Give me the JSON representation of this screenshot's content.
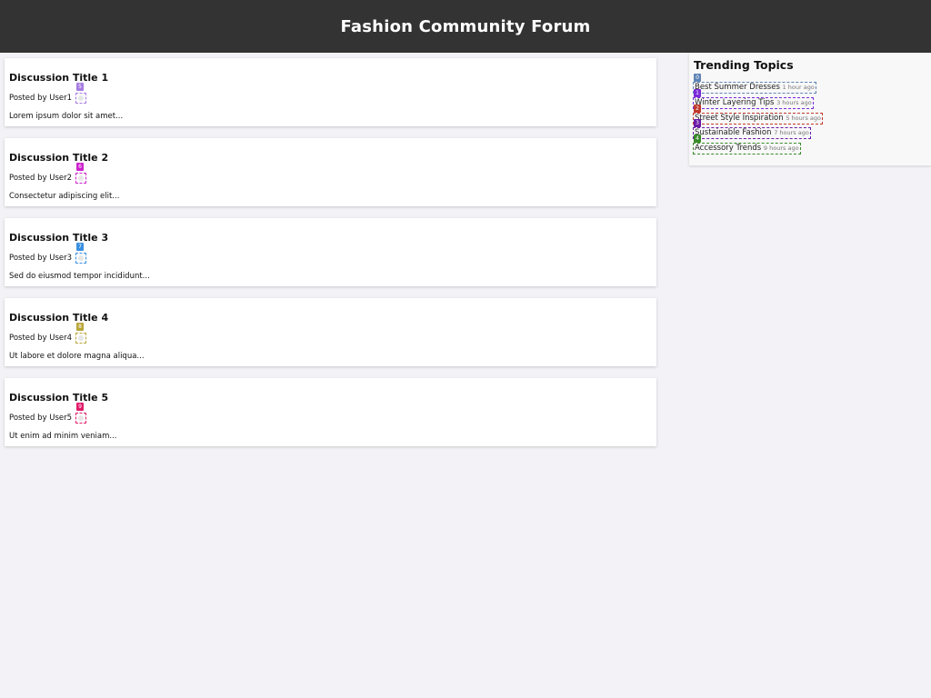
{
  "header": {
    "title": "Fashion Community Forum"
  },
  "posts": [
    {
      "title": "Discussion Title 1",
      "byline": "Posted by User1",
      "badge": "5",
      "badge_color": "#a67ce0",
      "excerpt": "Lorem ipsum dolor sit amet..."
    },
    {
      "title": "Discussion Title 2",
      "byline": "Posted by User2",
      "badge": "6",
      "badge_color": "#cc22cc",
      "excerpt": "Consectetur adipiscing elit..."
    },
    {
      "title": "Discussion Title 3",
      "byline": "Posted by User3",
      "badge": "7",
      "badge_color": "#3a8fe0",
      "excerpt": "Sed do eiusmod tempor incididunt..."
    },
    {
      "title": "Discussion Title 4",
      "byline": "Posted by User4",
      "badge": "8",
      "badge_color": "#b8a63a",
      "excerpt": "Ut labore et dolore magna aliqua..."
    },
    {
      "title": "Discussion Title 5",
      "byline": "Posted by User5",
      "badge": "9",
      "badge_color": "#e01c6a",
      "excerpt": "Ut enim ad minim veniam..."
    }
  ],
  "sidebar": {
    "title": "Trending Topics",
    "topics": [
      {
        "label": "Best Summer Dresses",
        "time": "1 hour ago",
        "badge": "0",
        "color": "#5e84b4"
      },
      {
        "label": "Winter Layering Tips",
        "time": "3 hours ago",
        "badge": "1",
        "color": "#7a2ad8"
      },
      {
        "label": "Street Style Inspiration",
        "time": "5 hours ago",
        "badge": "2",
        "color": "#c0392b"
      },
      {
        "label": "Sustainable Fashion",
        "time": "7 hours ago",
        "badge": "3",
        "color": "#6a1aa6"
      },
      {
        "label": "Accessory Trends",
        "time": "9 hours ago",
        "badge": "4",
        "color": "#3a8a2a"
      }
    ]
  }
}
